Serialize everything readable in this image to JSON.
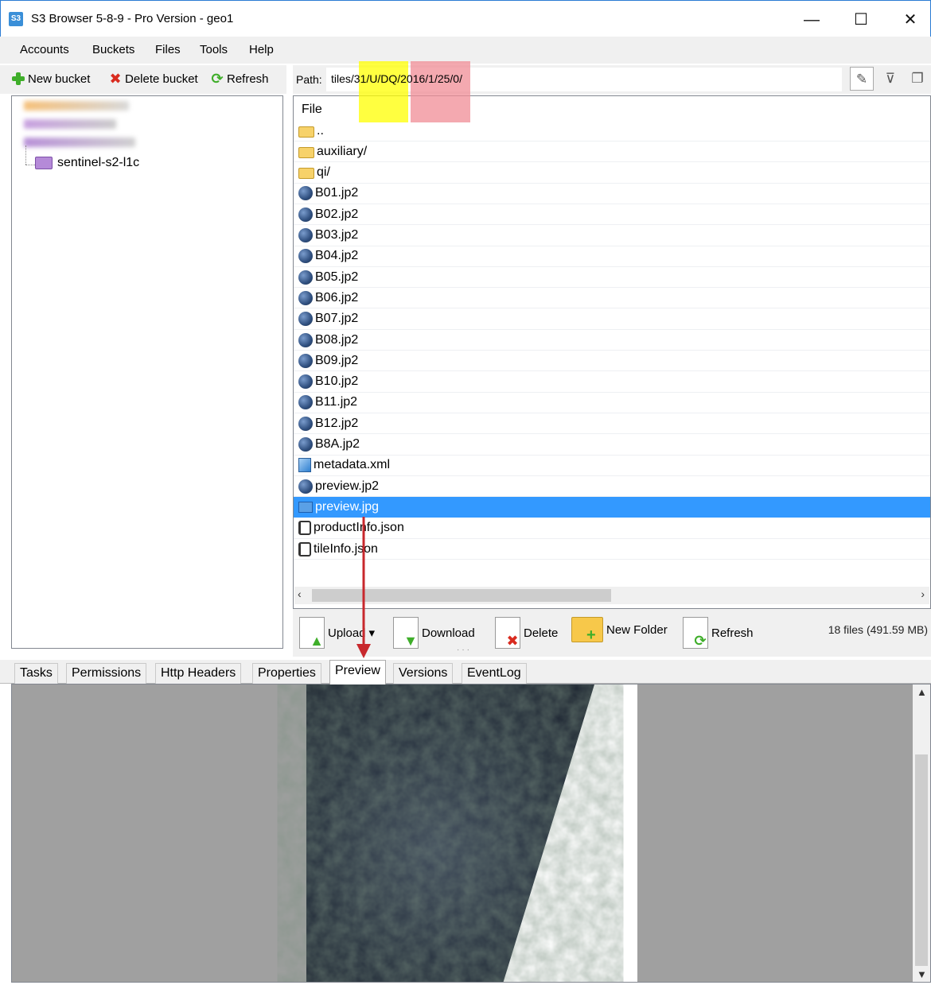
{
  "window": {
    "app_icon_text": "S3",
    "title": "S3 Browser 5-8-9 - Pro Version - geo1",
    "minimize_glyph": "—",
    "maximize_glyph": "☐",
    "close_glyph": "✕"
  },
  "menu": [
    "Accounts",
    "Buckets",
    "Files",
    "Tools",
    "Help"
  ],
  "left_toolbar": {
    "new_bucket": "New bucket",
    "delete_bucket": "Delete bucket",
    "refresh": "Refresh"
  },
  "tree": {
    "visible_bucket": "sentinel-s2-l1c"
  },
  "path": {
    "label": "Path:",
    "value": "tiles/31/U/DQ/2016/1/25/0/"
  },
  "path_tools": {
    "edit_icon": "pencil-icon",
    "filter_icon": "filter-icon",
    "copy_icon": "copy-icon"
  },
  "files": {
    "column_header": "File",
    "rows": [
      {
        "name": "..",
        "icon": "folder-icon"
      },
      {
        "name": "auxiliary/",
        "icon": "folder-icon"
      },
      {
        "name": "qi/",
        "icon": "folder-icon"
      },
      {
        "name": "B01.jp2",
        "icon": "globe-icon"
      },
      {
        "name": "B02.jp2",
        "icon": "globe-icon"
      },
      {
        "name": "B03.jp2",
        "icon": "globe-icon"
      },
      {
        "name": "B04.jp2",
        "icon": "globe-icon"
      },
      {
        "name": "B05.jp2",
        "icon": "globe-icon"
      },
      {
        "name": "B06.jp2",
        "icon": "globe-icon"
      },
      {
        "name": "B07.jp2",
        "icon": "globe-icon"
      },
      {
        "name": "B08.jp2",
        "icon": "globe-icon"
      },
      {
        "name": "B09.jp2",
        "icon": "globe-icon"
      },
      {
        "name": "B10.jp2",
        "icon": "globe-icon"
      },
      {
        "name": "B11.jp2",
        "icon": "globe-icon"
      },
      {
        "name": "B12.jp2",
        "icon": "globe-icon"
      },
      {
        "name": "B8A.jp2",
        "icon": "globe-icon"
      },
      {
        "name": "metadata.xml",
        "icon": "xml-file-icon"
      },
      {
        "name": "preview.jp2",
        "icon": "globe-icon"
      },
      {
        "name": "preview.jpg",
        "icon": "image-file-icon",
        "selected": true
      },
      {
        "name": "productInfo.json",
        "icon": "json-file-icon"
      },
      {
        "name": "tileInfo.json",
        "icon": "json-file-icon"
      }
    ]
  },
  "bottom_toolbar": {
    "upload": "Upload",
    "upload_dropdown": "▾",
    "download": "Download",
    "delete": "Delete",
    "new_folder": "New Folder",
    "refresh": "Refresh",
    "status": "18 files (491.59 MB)"
  },
  "tabs": [
    "Tasks",
    "Permissions",
    "Http Headers",
    "Properties",
    "Preview",
    "Versions",
    "EventLog"
  ],
  "active_tab": "Preview",
  "colors": {
    "selection": "#3399ff",
    "highlight_yellow": "#ffff00",
    "highlight_pink": "#f08c96",
    "annotation_arrow": "#c8282d"
  }
}
